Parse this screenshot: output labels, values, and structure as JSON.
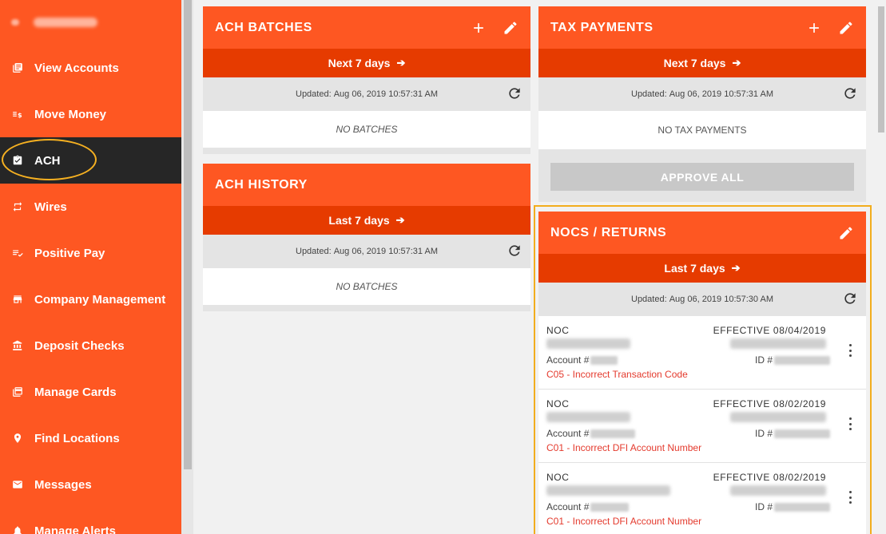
{
  "sidebar": {
    "items": [
      {
        "label": "View Accounts",
        "icon": "accounts-icon"
      },
      {
        "label": "Move Money",
        "icon": "move-money-icon"
      },
      {
        "label": "ACH",
        "icon": "ach-icon",
        "active": true
      },
      {
        "label": "Wires",
        "icon": "wires-icon"
      },
      {
        "label": "Positive Pay",
        "icon": "positive-pay-icon"
      },
      {
        "label": "Company Management",
        "icon": "company-icon"
      },
      {
        "label": "Deposit Checks",
        "icon": "bank-icon"
      },
      {
        "label": "Manage Cards",
        "icon": "cards-icon"
      },
      {
        "label": "Find Locations",
        "icon": "location-pin-icon"
      },
      {
        "label": "Messages",
        "icon": "envelope-icon"
      },
      {
        "label": "Manage Alerts",
        "icon": "bell-icon"
      }
    ]
  },
  "ach_batches": {
    "title": "ACH BATCHES",
    "range": "Next 7 days",
    "updated_label": "Updated:",
    "updated": "Aug 06, 2019 10:57:31 AM",
    "empty": "NO BATCHES"
  },
  "ach_history": {
    "title": "ACH HISTORY",
    "range": "Last 7 days",
    "updated_label": "Updated:",
    "updated": "Aug 06, 2019 10:57:31 AM",
    "empty": "NO BATCHES"
  },
  "tax_payments": {
    "title": "TAX PAYMENTS",
    "range": "Next 7 days",
    "updated_label": "Updated:",
    "updated": "Aug 06, 2019 10:57:31 AM",
    "empty": "NO TAX PAYMENTS",
    "approve_all": "APPROVE ALL"
  },
  "nocs": {
    "title": "NOCS / RETURNS",
    "range": "Last 7 days",
    "updated_label": "Updated:",
    "updated": "Aug 06, 2019 10:57:30 AM",
    "account_label": "Account #",
    "id_label": "ID #",
    "rows": [
      {
        "type": "NOC",
        "effective": "EFFECTIVE 08/04/2019",
        "reason": "C05 - Incorrect Transaction Code"
      },
      {
        "type": "NOC",
        "effective": "EFFECTIVE 08/02/2019",
        "reason": "C01 - Incorrect DFI Account Number"
      },
      {
        "type": "NOC",
        "effective": "EFFECTIVE 08/02/2019",
        "reason": "C01 - Incorrect DFI Account Number"
      }
    ]
  },
  "colors": {
    "brand": "#fe5722",
    "brand_dark": "#e63b00",
    "sidebar_active": "#262626",
    "highlight": "#f2ad1d",
    "error_text": "#e43a2d"
  }
}
